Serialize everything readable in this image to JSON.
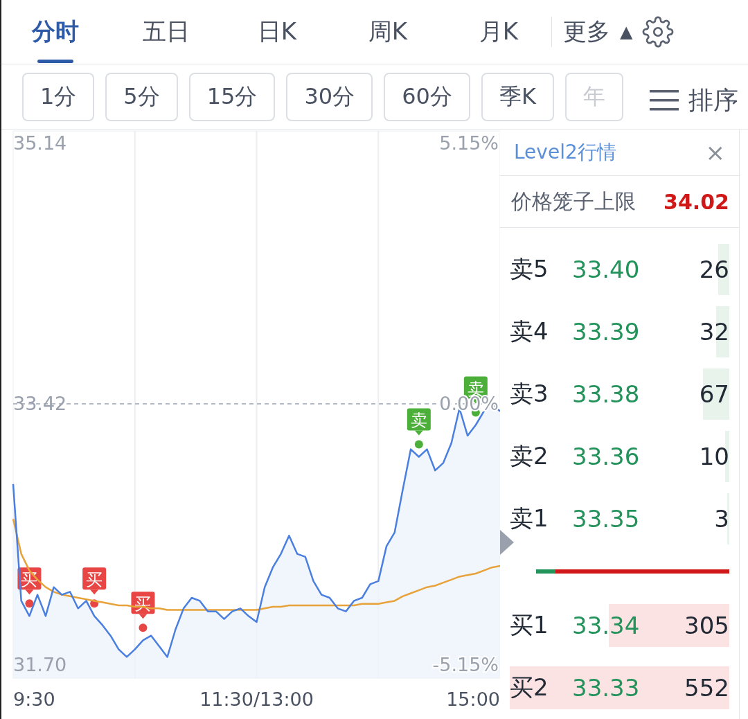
{
  "tabs": [
    {
      "label": "分时",
      "selected": true
    },
    {
      "label": "五日",
      "selected": false
    },
    {
      "label": "日K",
      "selected": false
    },
    {
      "label": "周K",
      "selected": false
    },
    {
      "label": "月K",
      "selected": false
    }
  ],
  "more": {
    "label": "更多",
    "arrow": "▲"
  },
  "periods": [
    {
      "label": "1分",
      "faded": false
    },
    {
      "label": "5分",
      "faded": false
    },
    {
      "label": "15分",
      "faded": false
    },
    {
      "label": "30分",
      "faded": false
    },
    {
      "label": "60分",
      "faded": false
    },
    {
      "label": "季K",
      "faded": false
    },
    {
      "label": "年",
      "faded": true
    }
  ],
  "sort": {
    "label": "排序"
  },
  "chart": {
    "chart_data": {
      "type": "line",
      "grid": true,
      "ylim": [
        31.61,
        35.22
      ],
      "yticks": [
        {
          "value": 35.14,
          "label": "35.14"
        },
        {
          "value": 33.42,
          "label": "33.42"
        },
        {
          "value": 31.7,
          "label": "31.70"
        }
      ],
      "series": [
        {
          "color": "#4a7fe0",
          "values": [
            32.89,
            32.12,
            32.02,
            32.16,
            32.02,
            32.21,
            32.16,
            32.18,
            32.07,
            32.12,
            32.02,
            31.96,
            31.89,
            31.8,
            31.75,
            31.8,
            31.86,
            31.89,
            31.82,
            31.75,
            31.93,
            32.07,
            32.14,
            32.12,
            32.05,
            32.05,
            32.0,
            32.05,
            32.07,
            32.02,
            31.98,
            32.21,
            32.34,
            32.43,
            32.55,
            32.43,
            32.41,
            32.25,
            32.16,
            32.14,
            32.07,
            32.05,
            32.12,
            32.14,
            32.23,
            32.25,
            32.48,
            32.57,
            32.85,
            33.12,
            33.07,
            33.12,
            32.98,
            33.03,
            33.16,
            33.39,
            33.21,
            33.28,
            33.37,
            33.42,
            33.37
          ]
        },
        {
          "color": "#e8a23a",
          "values": [
            32.66,
            32.43,
            32.32,
            32.26,
            32.21,
            32.18,
            32.16,
            32.15,
            32.14,
            32.13,
            32.12,
            32.11,
            32.1,
            32.09,
            32.09,
            32.08,
            32.08,
            32.07,
            32.07,
            32.06,
            32.06,
            32.06,
            32.06,
            32.06,
            32.06,
            32.06,
            32.06,
            32.06,
            32.06,
            32.06,
            32.06,
            32.07,
            32.08,
            32.08,
            32.09,
            32.09,
            32.09,
            32.09,
            32.09,
            32.09,
            32.09,
            32.09,
            32.09,
            32.1,
            32.1,
            32.1,
            32.11,
            32.12,
            32.15,
            32.17,
            32.19,
            32.21,
            32.22,
            32.24,
            32.26,
            32.28,
            32.29,
            32.3,
            32.32,
            32.34,
            32.35
          ]
        },
        {
          "color": "#9aa4b4",
          "line_style": "dashed",
          "values": [
            33.42,
            33.42,
            33.42,
            33.42,
            33.42,
            33.42,
            33.42,
            33.42,
            33.42,
            33.42,
            33.42,
            33.42,
            33.42,
            33.42,
            33.42,
            33.42,
            33.42,
            33.42,
            33.42,
            33.42,
            33.42,
            33.42,
            33.42,
            33.42,
            33.42,
            33.42,
            33.42,
            33.42,
            33.42,
            33.42,
            33.42,
            33.42,
            33.42,
            33.42,
            33.42,
            33.42,
            33.42,
            33.42,
            33.42,
            33.42,
            33.42,
            33.42,
            33.42,
            33.42,
            33.42,
            33.42,
            33.42,
            33.42,
            33.42,
            33.42,
            33.42,
            33.42,
            33.42,
            33.42,
            33.42,
            33.42,
            33.42,
            33.42,
            33.42,
            33.42,
            33.42
          ]
        }
      ]
    },
    "percent_labels": [
      {
        "label": "5.15%"
      },
      {
        "label": "0.00%"
      },
      {
        "label": "-5.15%"
      }
    ],
    "time_labels": [
      {
        "label": "9:30"
      },
      {
        "label": "11:30/13:00"
      },
      {
        "label": "15:00"
      }
    ],
    "signals": [
      {
        "label": "买",
        "kind": "buy"
      },
      {
        "label": "买",
        "kind": "buy"
      },
      {
        "label": "买",
        "kind": "buy"
      },
      {
        "label": "卖",
        "kind": "sell"
      },
      {
        "label": "卖",
        "kind": "sell"
      }
    ]
  },
  "panel": {
    "title": "Level2行情",
    "close": "×",
    "cage_label": "价格笼子上限",
    "cage_value": "34.02",
    "asks": [
      {
        "label": "卖5",
        "price": "33.40",
        "volume": "26",
        "level": 0.05
      },
      {
        "label": "卖4",
        "price": "33.39",
        "volume": "32",
        "level": 0.06
      },
      {
        "label": "卖3",
        "price": "33.38",
        "volume": "67",
        "level": 0.12
      },
      {
        "label": "卖2",
        "price": "33.36",
        "volume": "10",
        "level": 0.02
      },
      {
        "label": "卖1",
        "price": "33.35",
        "volume": "3",
        "level": 0.01
      }
    ],
    "ratio": {
      "level": 0.1
    },
    "bids": [
      {
        "label": "买1",
        "price": "33.34",
        "volume": "305",
        "level": 0.55
      },
      {
        "label": "买2",
        "price": "33.33",
        "volume": "552",
        "level": 1.0
      }
    ]
  }
}
